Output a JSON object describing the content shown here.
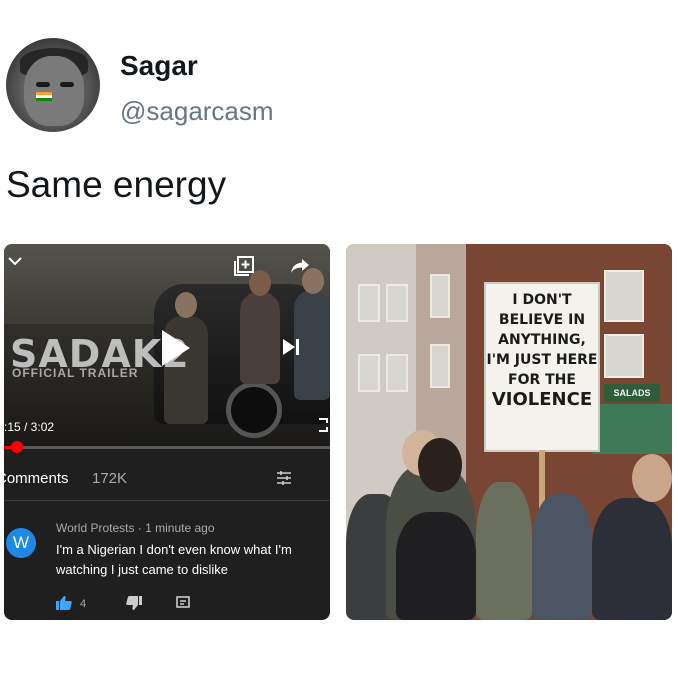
{
  "tweet": {
    "display_name": "Sagar",
    "handle": "@sagarcasm",
    "text": "Same energy"
  },
  "youtube": {
    "video_title": "SADAK2",
    "video_subtitle": "OFFICIAL TRAILER",
    "time": ":15 / 3:02",
    "progress": 0.02,
    "comments_label": "Comments",
    "comments_count": "172K",
    "comment": {
      "avatar_letter": "W",
      "author_line": "World Protests · 1 minute ago",
      "text": "I'm a Nigerian I don't even know what I'm watching I just came to dislike",
      "likes": "4"
    },
    "colors": {
      "background": "#1f1f1f",
      "progress": "#ff0000",
      "avatar": "#1e88e5",
      "like": "#3ea6ff"
    }
  },
  "photo": {
    "sign_lines": [
      "I DON'T",
      "BELIEVE IN",
      "ANYTHING,",
      "I'M JUST HERE",
      "FOR THE",
      "VIOLENCE"
    ],
    "store_sign": "SALADS"
  }
}
